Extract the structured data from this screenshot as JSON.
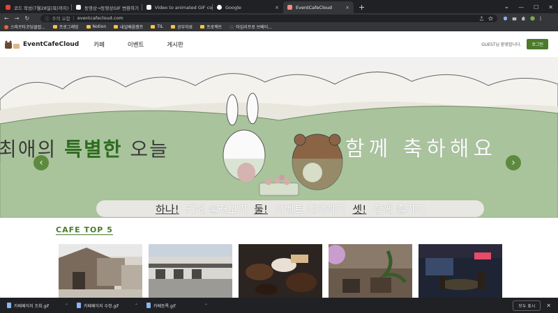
{
  "browser": {
    "tabs": [
      {
        "title": "코드 작성(7월28일(목)까지)",
        "color": "#e94235"
      },
      {
        "title": "동영상→동영상GIF 변환하기",
        "color": "#f5f5f5"
      },
      {
        "title": "Video to animated GIF conver",
        "color": "#f5f5f5"
      },
      {
        "title": "Google",
        "color": "#ffffff"
      },
      {
        "title": "EventCafeCloud",
        "color": "#f28b82"
      }
    ],
    "new_tab": "+",
    "tab_close": "×",
    "caret": "⌄",
    "win_min": "—",
    "win_max": "☐",
    "win_close": "✕",
    "nav_back": "←",
    "nav_forward": "→",
    "nav_reload": "↻",
    "lock": "ⓘ",
    "security_label": "주의 요함",
    "url": "eventcafecloud.com",
    "bookmarks": [
      {
        "label": "스파르타코딩클럽..."
      },
      {
        "label": "프로그래밍"
      },
      {
        "label": "Notion"
      },
      {
        "label": "내일배움캠프"
      },
      {
        "label": "TIL"
      },
      {
        "label": "공부자료"
      },
      {
        "label": "프로젝트"
      },
      {
        "label": "타임리프로 브베이..."
      }
    ]
  },
  "site": {
    "logo_text": "EventCafeCloud",
    "menu": [
      "카페",
      "이벤트",
      "게시판"
    ],
    "greeting": "GUEST님 환영합니다.",
    "login_label": "로그인",
    "hero": {
      "line_part1": "최애의 ",
      "line_part2": "특별한",
      "line_part3": " 오늘",
      "line_part4": "함께 축하해요",
      "pill": [
        {
          "key": "하나!",
          "text": "카페 둘러보기"
        },
        {
          "key": "둘!",
          "text": "이벤트 예약하기"
        },
        {
          "key": "셋!",
          "text": "함께 즐기기"
        }
      ],
      "prev": "‹",
      "next": "›"
    },
    "section_title": "CAFE TOP 5"
  },
  "downloads": {
    "items": [
      "카페페이지 조회.gif",
      "카페페이지 수정.gif",
      "카페등록.gif"
    ],
    "caret": "⌃",
    "show_all": "모두 표시",
    "close": "✕"
  },
  "colors": {
    "accent": "#4a7a2a",
    "hero_bg": "#a9c49c"
  }
}
